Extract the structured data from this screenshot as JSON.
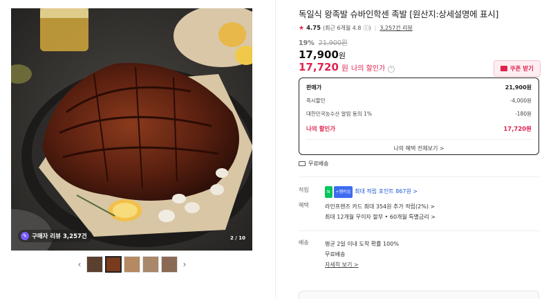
{
  "gallery": {
    "review_badge": "구매자 리뷰 3,257건",
    "counter": "2 / 10",
    "prev_arrow": "‹",
    "next_arrow": "›"
  },
  "product": {
    "title": "독일식 왕족발 슈바인학센 족발 [원산지:상세설명에 표시]",
    "rating": "4.75",
    "rating_recent": "(최근 6개월 4.8",
    "review_count": "3,257건 리뷰",
    "discount_pct": "19%",
    "original_price": "21,900원",
    "price": "17,900",
    "price_unit": "원",
    "my_price": "17,720",
    "my_price_unit": "원",
    "my_price_label": "나의 할인가",
    "coupon_label": "쿠폰 받기"
  },
  "breakdown": {
    "rows": [
      {
        "label": "판매가",
        "value": "21,900원"
      },
      {
        "label": "즉시할인",
        "value": "-4,000원"
      },
      {
        "label": "대한민국농수산 알림 동의 1%",
        "value": "-180원"
      }
    ],
    "sale_label": "나의 할인가",
    "sale_value": "17,720원",
    "benefit_link": "나의 혜택 전체보기 >"
  },
  "shipping_badge": "무료배송",
  "points": {
    "key": "적립",
    "npay": "N",
    "npay2": "+멤버십",
    "text": "최대 적립 포인트 867원 >"
  },
  "benefits": {
    "key": "혜택",
    "line1": "라인프렌즈 카드 최대 354원 추가 적립(2%) >",
    "line2": "최대 12개월 무이자 할부 • 60개월 특별금리 >"
  },
  "delivery": {
    "key": "배송",
    "line1": "평균 2일 이내 도착 확률 100%",
    "line2": "무료배송",
    "link": "자세히 보기 >"
  },
  "colors": {
    "accent": "#e0234e",
    "point_link": "#1b55d6"
  }
}
